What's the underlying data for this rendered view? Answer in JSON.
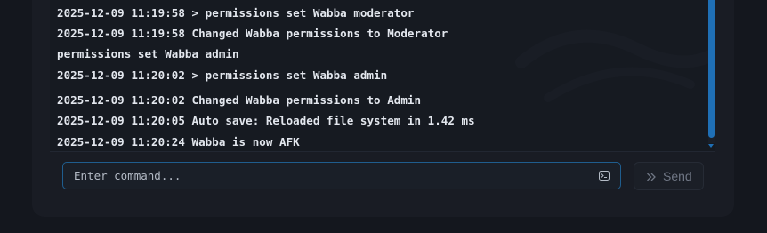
{
  "console": {
    "lines": [
      "2025-12-09 11:19:58 > permissions set Wabba moderator",
      "2025-12-09 11:19:58 Changed Wabba permissions to Moderator",
      "permissions set Wabba admin",
      "2025-12-09 11:20:02 > permissions set Wabba admin",
      "2025-12-09 11:20:02 Changed Wabba permissions to Admin",
      "2025-12-09 11:20:05 Auto save: Reloaded file system in 1.42 ms",
      "2025-12-09 11:20:24 Wabba is now AFK"
    ]
  },
  "command": {
    "placeholder": "Enter command...",
    "value": "",
    "icon": "terminal-icon"
  },
  "send": {
    "label": "Send",
    "icon": "double-chevron-right-icon"
  },
  "colors": {
    "background": "#14171e",
    "accent": "#1f6fb5",
    "text": "#e3e7ee"
  }
}
